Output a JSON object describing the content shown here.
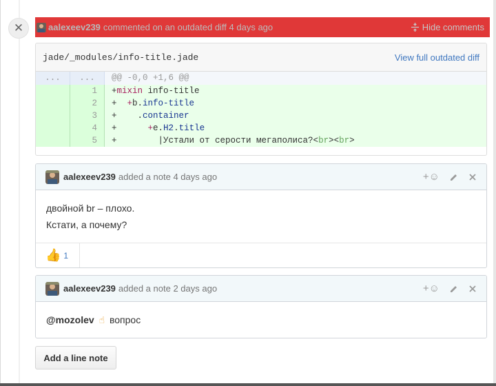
{
  "outdated_bar": {
    "author": "aalexeev239",
    "meta": "commented on an outdated diff 4 days ago",
    "hide_label": "Hide comments"
  },
  "diff": {
    "file_path": "jade/_modules/info-title.jade",
    "view_full_label": "View full outdated diff",
    "hunk": {
      "n1": "...",
      "n2": "...",
      "text": "@@ -0,0 +1,6 @@"
    },
    "lines": [
      {
        "num": "1",
        "text": "+mixin info-title"
      },
      {
        "num": "2",
        "text": "+  +b.info-title"
      },
      {
        "num": "3",
        "text": "+    .container"
      },
      {
        "num": "4",
        "text": "+      +e.H2.title"
      },
      {
        "num": "5",
        "text": "+        |Устали от серости мегаполиса?<br><br>"
      }
    ]
  },
  "notes": [
    {
      "author": "aalexeev239",
      "meta": "added a note 4 days ago",
      "body_line1": "двойной br – плохо.",
      "body_line2": "Кстати, а почему?",
      "reaction_count": "1"
    },
    {
      "author": "aalexeev239",
      "meta": "added a note 2 days ago",
      "mention": "@mozolev",
      "emoji": "☝",
      "body_text": "вопрос"
    }
  ],
  "actions": {
    "add_reaction": "+☺",
    "add_line_note": "Add a line note"
  },
  "colors": {
    "outdated_bar": "#e03838",
    "link": "#4078c0",
    "diff_add_bg": "#eaffea",
    "note_header_bg": "#f2f8fa"
  },
  "icons": {
    "close": "close-icon",
    "fold": "fold-icon",
    "edit": "pencil-icon",
    "delete": "x-icon",
    "reaction": "smiley-icon",
    "thumbs_up": "thumbs-up-icon"
  }
}
